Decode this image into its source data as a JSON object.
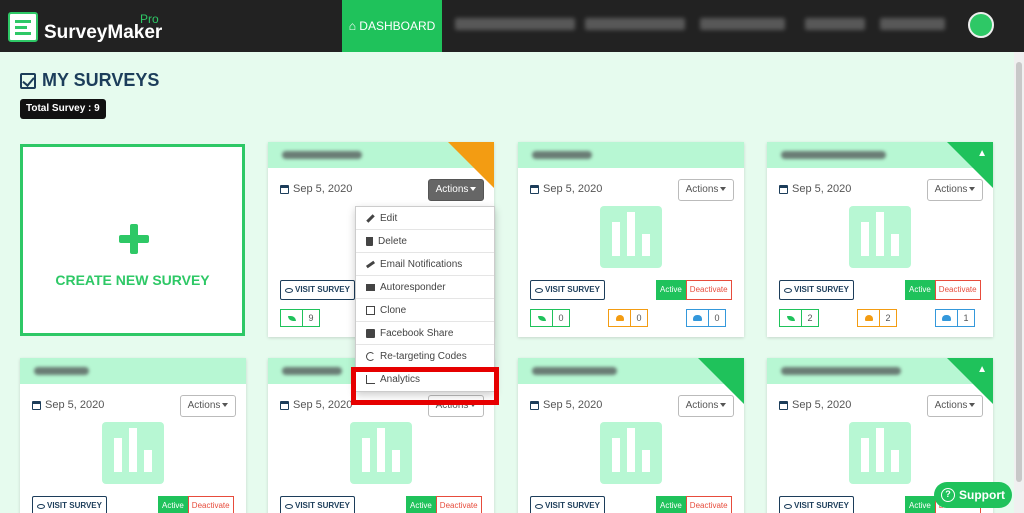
{
  "navbar": {
    "brand": "SurveyMaker",
    "brand_suffix": "Pro",
    "dashboard_label": "DASHBOARD"
  },
  "page": {
    "title": "MY SURVEYS",
    "total_badge": "Total Survey : 9"
  },
  "create_card": {
    "label": "CREATE NEW SURVEY"
  },
  "cards": [
    {
      "date": "Sep 5, 2020",
      "actions": "Actions",
      "visit": "VISIT SURVEY",
      "stats": [
        "9"
      ]
    },
    {
      "date": "Sep 5, 2020",
      "actions": "Actions",
      "visit": "VISIT SURVEY",
      "active": "Active",
      "deactivate": "Deactivate",
      "stats": [
        "0",
        "0",
        "0"
      ]
    },
    {
      "date": "Sep 5, 2020",
      "actions": "Actions",
      "visit": "VISIT SURVEY",
      "active": "Active",
      "deactivate": "Deactivate",
      "stats": [
        "2",
        "2",
        "1"
      ]
    },
    {
      "date": "Sep 5, 2020",
      "actions": "Actions",
      "visit": "VISIT SURVEY",
      "active": "Active",
      "deactivate": "Deactivate"
    },
    {
      "date": "Sep 5, 2020",
      "actions": "Actions",
      "visit": "VISIT SURVEY",
      "active": "Active",
      "deactivate": "Deactivate"
    },
    {
      "date": "Sep 5, 2020",
      "actions": "Actions",
      "visit": "VISIT SURVEY",
      "active": "Active",
      "deactivate": "Deactivate"
    },
    {
      "date": "Sep 5, 2020",
      "actions": "Actions",
      "visit": "VISIT SURVEY",
      "active": "Active",
      "deactivate": "Deactivate"
    }
  ],
  "dropdown": [
    "Edit",
    "Delete",
    "Email Notifications",
    "Autoresponder",
    "Clone",
    "Facebook Share",
    "Re-targeting Codes",
    "Analytics"
  ],
  "support": {
    "label": "Support",
    "icon": "?"
  },
  "colors": {
    "brand_green": "#1fc25b",
    "tile_green": "#b7f7d3",
    "navy": "#1c3d5a",
    "highlight_red": "#e60000"
  }
}
